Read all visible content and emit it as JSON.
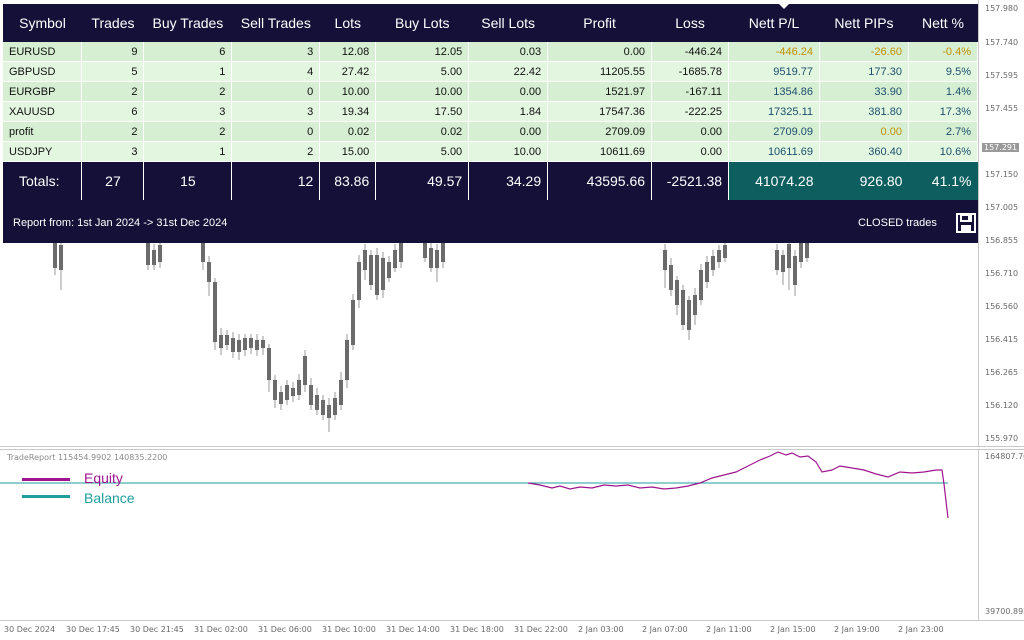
{
  "colors": {
    "panel_bg": "#151038",
    "row_light": "#e3f6e0",
    "row_dark": "#d6eed2",
    "totals_teal": "#0d5f5f",
    "neutral_text": "#c28f00",
    "positive_text": "#1b4f6d",
    "bull_candle": "#bfcf74",
    "bear_candle": "#6b6b6b",
    "equity_color": "#a0158f",
    "balance_color": "#1d9e9c"
  },
  "price_axis": [
    "157.980",
    "157.740",
    "157.595",
    "157.455",
    "157.150",
    "157.005",
    "156.855",
    "156.710",
    "156.560",
    "156.415",
    "156.265",
    "156.120",
    "155.970"
  ],
  "current_price": "157.291",
  "sub_axis": {
    "top": "164807.70",
    "bottom": "39700.892"
  },
  "indicator": {
    "title": "TradeReport 115454.9902 140835.2200",
    "equity_label": "Equity",
    "balance_label": "Balance"
  },
  "time_axis": [
    "30 Dec 2024",
    "30 Dec 17:45",
    "30 Dec 21:45",
    "31 Dec 02:00",
    "31 Dec 06:00",
    "31 Dec 10:00",
    "31 Dec 14:00",
    "31 Dec 18:00",
    "31 Dec 22:00",
    "2 Jan 03:00",
    "2 Jan 07:00",
    "2 Jan 11:00",
    "2 Jan 15:00",
    "2 Jan 19:00",
    "2 Jan 23:00"
  ],
  "report": {
    "headers": [
      "Symbol",
      "Trades",
      "Buy Trades",
      "Sell Trades",
      "Lots",
      "Buy Lots",
      "Sell Lots",
      "Profit",
      "Loss",
      "Nett P/L",
      "Nett PIPs",
      "Nett %"
    ],
    "rows": [
      [
        "EURUSD",
        "9",
        "6",
        "3",
        "12.08",
        "12.05",
        "0.03",
        "0.00",
        "-446.24",
        "-446.24",
        "-26.60",
        "-0.4%"
      ],
      [
        "GBPUSD",
        "5",
        "1",
        "4",
        "27.42",
        "5.00",
        "22.42",
        "11205.55",
        "-1685.78",
        "9519.77",
        "177.30",
        "9.5%"
      ],
      [
        "EURGBP",
        "2",
        "2",
        "0",
        "10.00",
        "10.00",
        "0.00",
        "1521.97",
        "-167.11",
        "1354.86",
        "33.90",
        "1.4%"
      ],
      [
        "XAUUSD",
        "6",
        "3",
        "3",
        "19.34",
        "17.50",
        "1.84",
        "17547.36",
        "-222.25",
        "17325.11",
        "381.80",
        "17.3%"
      ],
      [
        "profit",
        "2",
        "2",
        "0",
        "0.02",
        "0.02",
        "0.00",
        "2709.09",
        "0.00",
        "2709.09",
        "0.00",
        "2.7%"
      ],
      [
        "USDJPY",
        "3",
        "1",
        "2",
        "15.00",
        "5.00",
        "10.00",
        "10611.69",
        "0.00",
        "10611.69",
        "360.40",
        "10.6%"
      ]
    ],
    "neutral_cells": [
      [
        0,
        9
      ],
      [
        0,
        10
      ],
      [
        0,
        11
      ],
      [
        4,
        10
      ]
    ],
    "totals": [
      "Totals:",
      "27",
      "15",
      "12",
      "83.86",
      "49.57",
      "34.29",
      "43595.66",
      "-2521.38",
      "41074.28",
      "926.80",
      "41.1%"
    ],
    "period": "Report from: 1st Jan 2024 -> 31st Dec 2024",
    "mode": "CLOSED trades"
  }
}
